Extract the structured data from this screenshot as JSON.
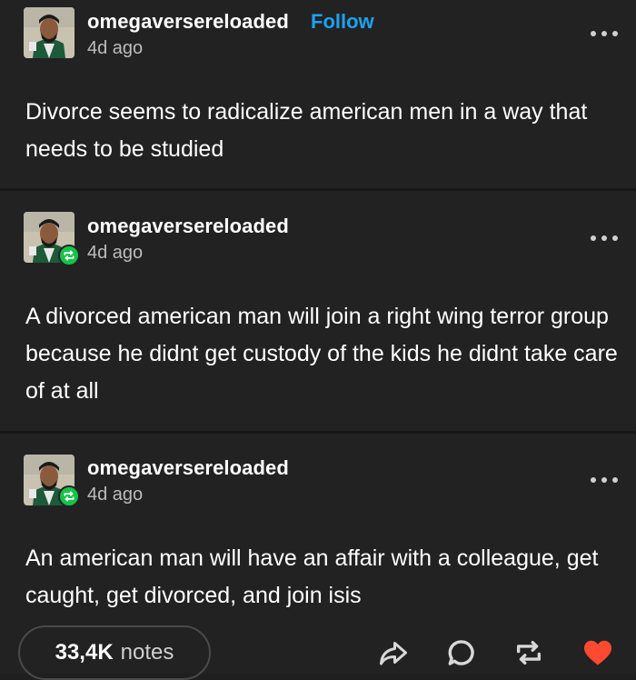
{
  "posts": [
    {
      "username": "omegaversereloaded",
      "follow_label": "Follow",
      "time": "4d ago",
      "text": "Divorce seems to radicalize american men in a way that needs to be studied"
    },
    {
      "username": "omegaversereloaded",
      "time": "4d ago",
      "text": "A divorced american man will join a right wing terror group because he didnt get custody of the kids he didnt take care of at all"
    },
    {
      "username": "omegaversereloaded",
      "time": "4d ago",
      "text": "An american man will have an affair with a colleague, get caught, get divorced, and join isis"
    }
  ],
  "footer": {
    "notes_count": "33,4K",
    "notes_label": "notes"
  },
  "icons": {
    "share": "share-icon",
    "reply": "reply-icon",
    "reblog": "reblog-icon",
    "like": "heart-icon"
  },
  "colors": {
    "background": "#222222",
    "follow": "#1da1f2",
    "reblog_badge": "#16c34a",
    "heart": "#ff4930"
  }
}
